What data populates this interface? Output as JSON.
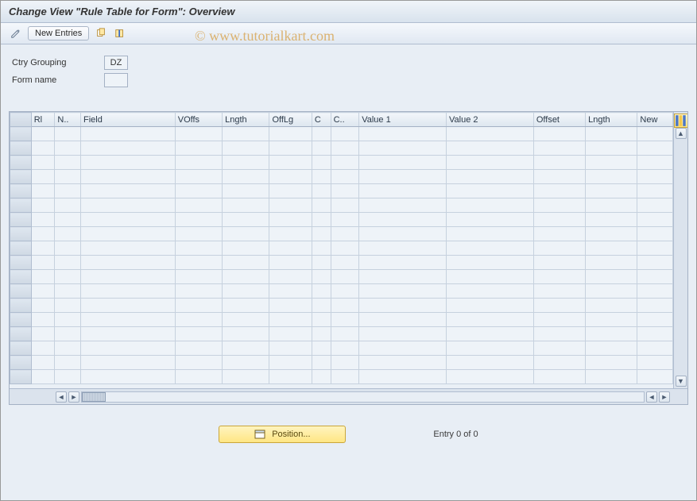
{
  "title": "Change View \"Rule Table for Form\": Overview",
  "toolbar": {
    "new_entries_label": "New Entries"
  },
  "watermark": "© www.tutorialkart.com",
  "form": {
    "ctry_grouping_label": "Ctry Grouping",
    "ctry_grouping_value": "DZ",
    "form_name_label": "Form name",
    "form_name_value": ""
  },
  "table": {
    "columns": [
      "Rl",
      "N..",
      "Field",
      "VOffs",
      "Lngth",
      "OffLg",
      "C",
      "C..",
      "Value 1",
      "Value 2",
      "Offset",
      "Lngth",
      "New"
    ],
    "rows": 18
  },
  "footer": {
    "position_label": "Position...",
    "entry_text": "Entry 0 of 0"
  }
}
